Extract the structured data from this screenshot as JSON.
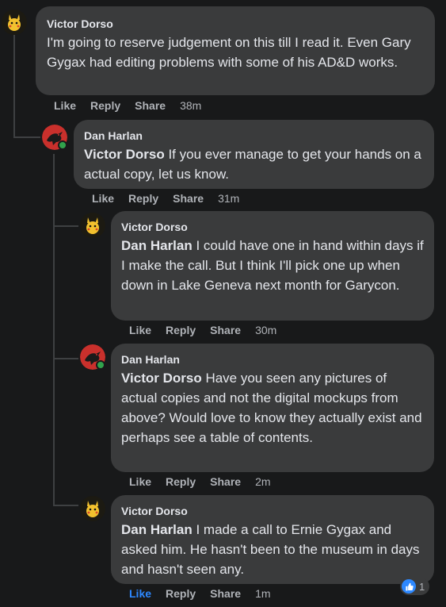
{
  "comments": [
    {
      "author": "Victor Dorso",
      "mention": "",
      "text": "I'm going to reserve judgement on this till I read it. Even Gary Gygax had editing problems with some of his AD&D works.",
      "actions": {
        "like": "Like",
        "reply": "Reply",
        "share": "Share",
        "time": "38m"
      }
    },
    {
      "author": "Dan Harlan",
      "mention": "Victor Dorso",
      "text": " If you ever manage to get your hands on a actual copy, let us know.",
      "actions": {
        "like": "Like",
        "reply": "Reply",
        "share": "Share",
        "time": "31m"
      }
    },
    {
      "author": "Victor Dorso",
      "mention": "Dan Harlan",
      "text": " I could have one in hand within days if I make the call. But I think I'll pick one up when down in Lake Geneva next month for Garycon.",
      "actions": {
        "like": "Like",
        "reply": "Reply",
        "share": "Share",
        "time": "30m"
      }
    },
    {
      "author": "Dan Harlan",
      "mention": "Victor Dorso",
      "text": " Have you seen any pictures of actual copies and not the digital mockups from above? Would love to know they actually exist and perhaps see a table of contents.",
      "actions": {
        "like": "Like",
        "reply": "Reply",
        "share": "Share",
        "time": "2m"
      }
    },
    {
      "author": "Victor Dorso",
      "mention": "Dan Harlan",
      "text": " I made a call to Ernie Gygax and asked him. He hasn't been to the museum in days and hasn't seen any.",
      "actions": {
        "like": "Like",
        "reply": "Reply",
        "share": "Share",
        "time": "1m"
      },
      "reaction_count": "1"
    }
  ],
  "colors": {
    "background": "#18191a",
    "bubble": "#3a3b3c",
    "text": "#e4e6eb",
    "secondary": "#b0b3b8",
    "accent": "#2d88ff",
    "online": "#31a24c"
  },
  "icons": {
    "victor_avatar": "pikachu-avatar",
    "dan_avatar": "red-dragon-avatar",
    "reaction": "thumbs-up-icon"
  }
}
